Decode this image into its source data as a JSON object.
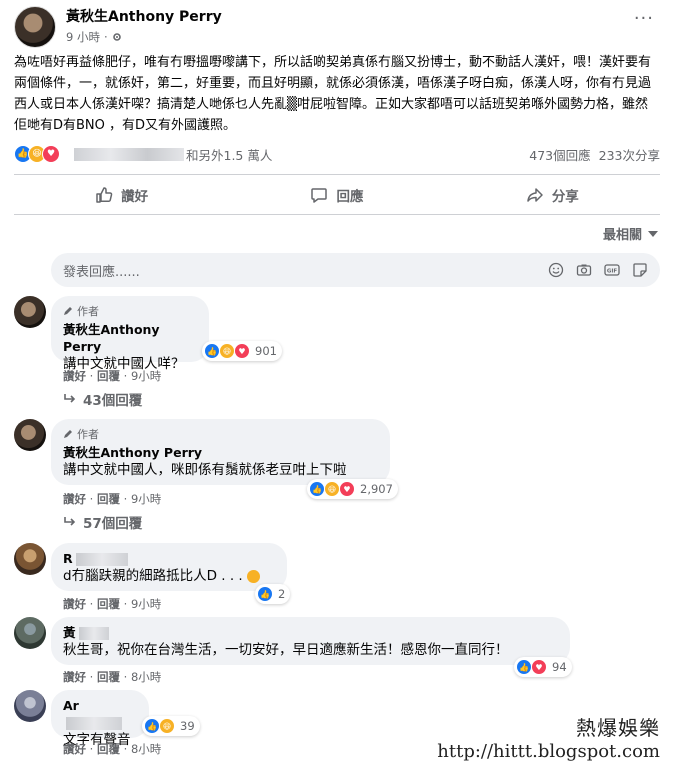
{
  "post": {
    "author": "黃秋生Anthony Perry",
    "time": "9 小時",
    "body": "為咗唔好再益條肥仔，唯有冇嘢搵嘢嚟講下，所以話啲契弟真係冇腦又扮博士，動不動話人漢奸，喂！漢奸要有兩個條件，一，就係奸，第二，好重要，而且好明顯，就係必須係漢，唔係漢子呀白痴，係漢人呀，你有冇見過西人或日本人係漢奸㗎？搞清楚人哋係乜人先亂▒咁屁啦智障。正如大家都唔可以話班契弟喺外國勢力格，雖然佢哋有D有BNO ，有D又有外國護照。",
    "reactions_text": "和另外1.5 萬人",
    "comments_count": "473個回應",
    "shares_count": "233次分享"
  },
  "actions": {
    "like": "讚好",
    "comment": "回應",
    "share": "分享"
  },
  "sort_label": "最相關",
  "comment_input": {
    "placeholder": "發表回應......"
  },
  "comments": [
    {
      "author_tag": "作者",
      "name": "黃秋生Anthony Perry",
      "text": "講中文就中國人咩？",
      "reactions": "901",
      "like": "讚好",
      "reply": "回覆",
      "time": "9小時",
      "replies": "43個回覆"
    },
    {
      "author_tag": "作者",
      "name": "黃秋生Anthony Perry",
      "text": "講中文就中國人，咪即係有鬚就係老豆咁上下啦",
      "reactions": "2,907",
      "like": "讚好",
      "reply": "回覆",
      "time": "9小時",
      "replies": "57個回覆"
    },
    {
      "name": "R",
      "text": "d冇腦趺親的細路抵比人D . . .",
      "reactions": "2",
      "like": "讚好",
      "reply": "回覆",
      "time": "9小時"
    },
    {
      "name": "黃",
      "text": "秋生哥，祝你在台灣生活，一切安好，早日適應新生活！感恩你一直同行！",
      "reactions": "94",
      "like": "讚好",
      "reply": "回覆",
      "time": "8小時"
    },
    {
      "name": "Ar",
      "text": "文字有聲音",
      "reactions": "39",
      "like": "讚好",
      "reply": "回覆",
      "time": "8小時"
    }
  ],
  "watermark": {
    "line1": "熱爆娛樂",
    "line2": "http://hittt.blogspot.com"
  },
  "colors": {
    "like_blue": "#1877f2",
    "haha_yellow": "#f7b125",
    "love_red": "#f33e58",
    "bubble_bg": "#f0f2f5",
    "secondary_text": "#65676b"
  }
}
